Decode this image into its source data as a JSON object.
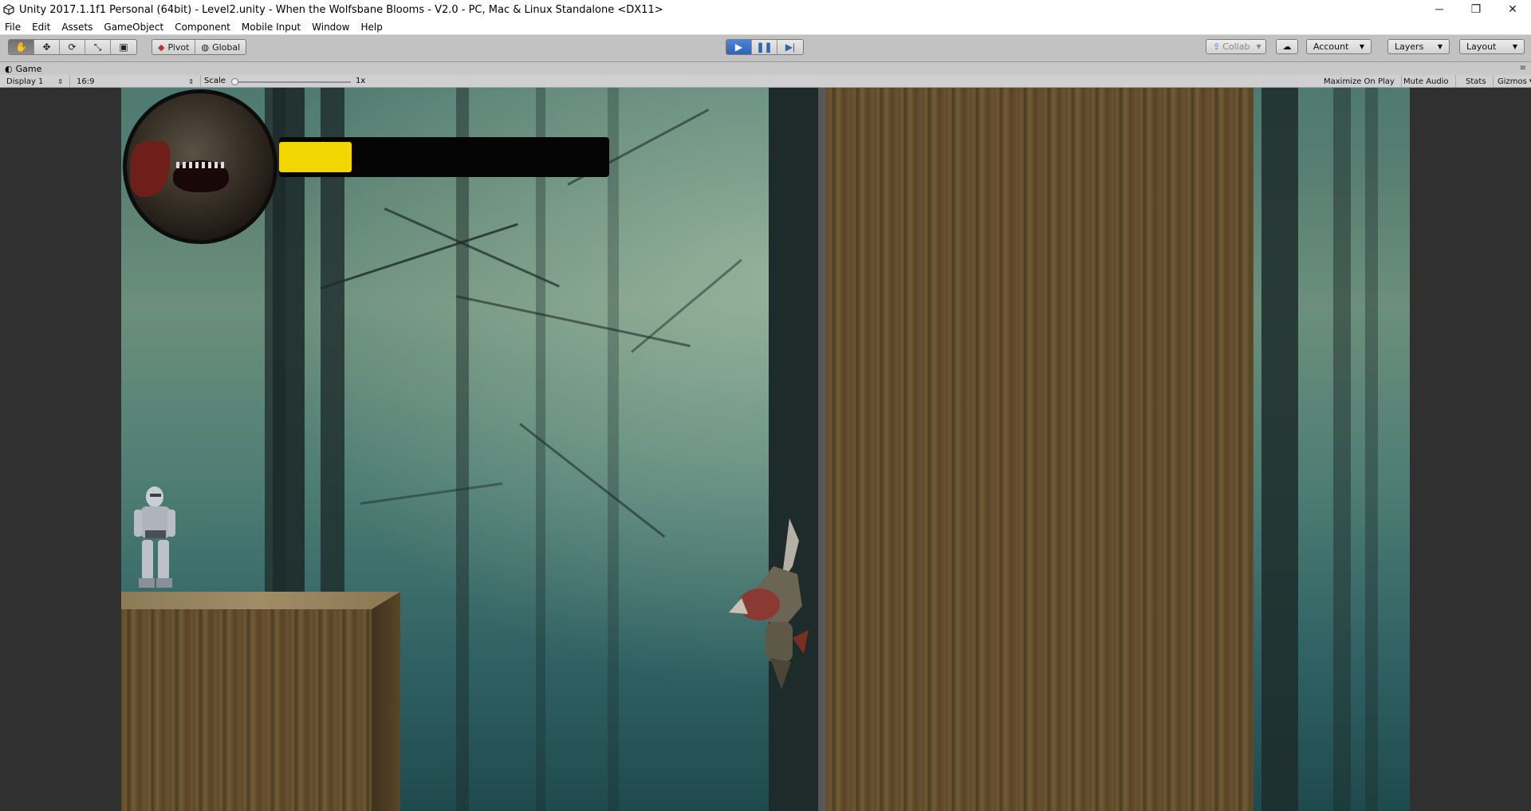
{
  "window": {
    "title": "Unity 2017.1.1f1 Personal (64bit) - Level2.unity - When the Wolfsbane Blooms - V2.0 - PC, Mac & Linux Standalone <DX11>",
    "minimize": "─",
    "maximize": "❐",
    "close": "✕"
  },
  "menu": [
    "File",
    "Edit",
    "Assets",
    "GameObject",
    "Component",
    "Mobile Input",
    "Window",
    "Help"
  ],
  "toolbar": {
    "pivot_label": "Pivot",
    "global_label": "Global",
    "collab_label": "Collab",
    "account_label": "Account",
    "layers_label": "Layers",
    "layout_label": "Layout",
    "play_state": "playing"
  },
  "game_view": {
    "tab_label": "Game",
    "display_label": "Display 1",
    "aspect_label": "16:9",
    "scale_label": "Scale",
    "scale_value": "1x",
    "maximize_label": "Maximize On Play",
    "mute_label": "Mute Audio",
    "stats_label": "Stats",
    "gizmos_label": "Gizmos"
  },
  "hud": {
    "boss_health_fraction": 0.22,
    "health_color": "#f1d600"
  },
  "colors": {
    "play_active": "#2d63b8",
    "forest_teal": "#4f7a70",
    "wood": "#6e5733"
  }
}
